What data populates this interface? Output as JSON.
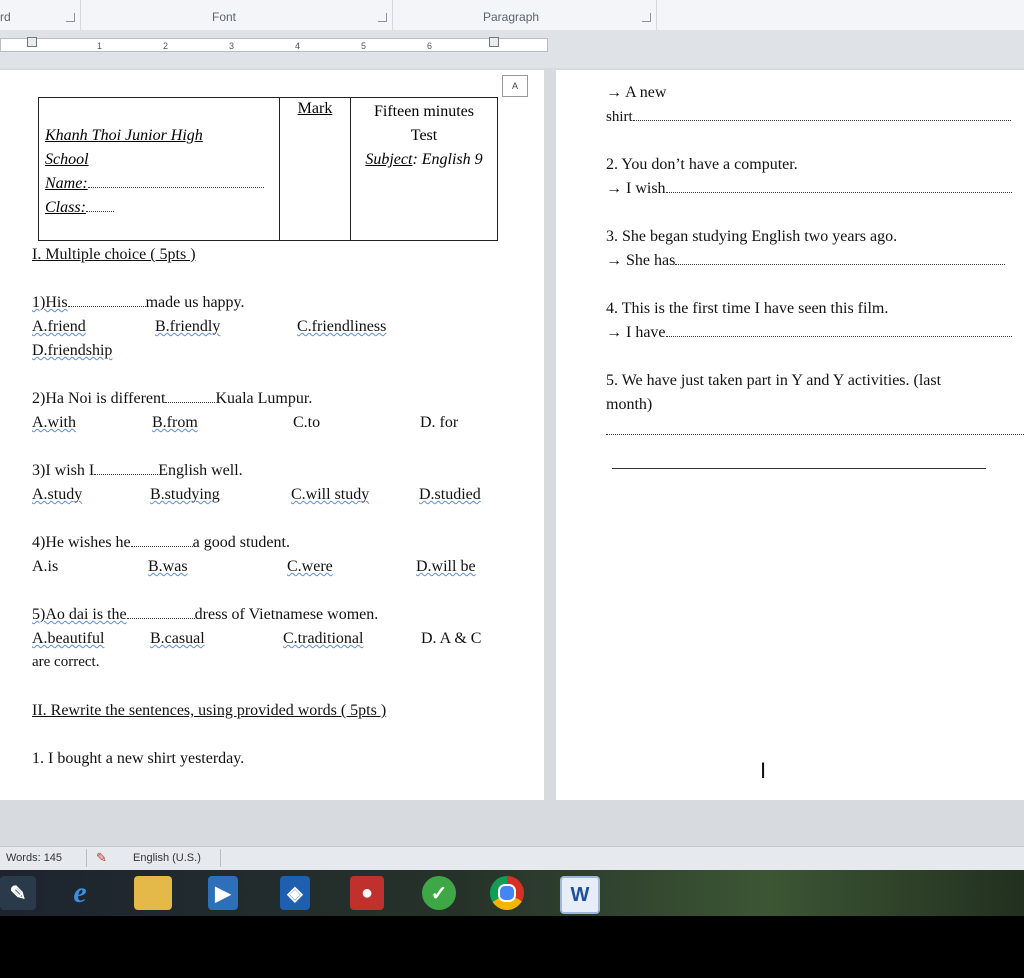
{
  "ribbon": {
    "cut_left": "rd",
    "font_label": "Font",
    "paragraph_label": "Paragraph"
  },
  "ruler": {
    "ticks": [
      "1",
      "2",
      "3",
      "4",
      "5",
      "6"
    ]
  },
  "page_marker": "A",
  "header_table": {
    "school_line1": "Khanh Thoi  Junior High",
    "school_line2": "School",
    "name_label": "Name:",
    "class_label": "Class:",
    "mark_label": "Mark",
    "test_line1": "Fifteen minutes",
    "test_line2": "Test",
    "subject_label": "Subject",
    "subject_value": ": English 9"
  },
  "section1_title": "I. Multiple choice ( 5pts )",
  "questions": [
    {
      "stem_a": "1)His",
      "stem_b": "made us happy.",
      "options": [
        "A.friend",
        "B.friendly",
        "C.friendliness",
        "D.friendship"
      ]
    },
    {
      "stem_a": "2)Ha Noi is different",
      "stem_b": "Kuala Lumpur.",
      "options": [
        "A.with",
        "B.from",
        "C.to",
        "D. for"
      ]
    },
    {
      "stem_a": "3)I wish I",
      "stem_b": "English well.",
      "options": [
        "A.study",
        "B.studying",
        "C.will study",
        "D.studied"
      ]
    },
    {
      "stem_a": "4)He wishes he",
      "stem_b": "a good student.",
      "options": [
        "A.is",
        "B.was",
        "C.were",
        "D.will be"
      ]
    },
    {
      "stem_a": "5)Ao dai is the",
      "stem_b": "dress of Vietnamese women.",
      "options": [
        "A.beautiful",
        "B.casual",
        "C.traditional",
        "D. A & C"
      ],
      "tail": "are correct."
    }
  ],
  "section2_title": "II. Rewrite the sentences, using provided words ( 5pts )",
  "rewrite_1": "1. I bought a new shirt yesterday.",
  "right_page": {
    "r1_arrow": "→ A new",
    "r1_cont": "shirt",
    "r2_q": "2. You don’t have a computer.",
    "r2_a": "→ I wish",
    "r3_q": "3. She began studying English two years ago.",
    "r3_a": "→ She has",
    "r4_q": "4. This is the first time I have seen this film.",
    "r4_a": "→ I have",
    "r5_q": "5. We have just taken  part in Y and Y activities. (last",
    "r5_q2": "month)"
  },
  "status_bar": {
    "words": "Words: 145",
    "language": "English (U.S.)"
  },
  "taskbar": {
    "icons": [
      "paint-icon",
      "internet-explorer-icon",
      "file-explorer-icon",
      "media-player-icon",
      "shield-app-icon",
      "video-recorder-icon",
      "green-app-icon",
      "chrome-icon",
      "word-icon"
    ],
    "word_letter": "W"
  },
  "colors": {
    "workspace": "#d7dbe0",
    "taskbar": "#1d2430",
    "status": "#e6e9ee"
  }
}
